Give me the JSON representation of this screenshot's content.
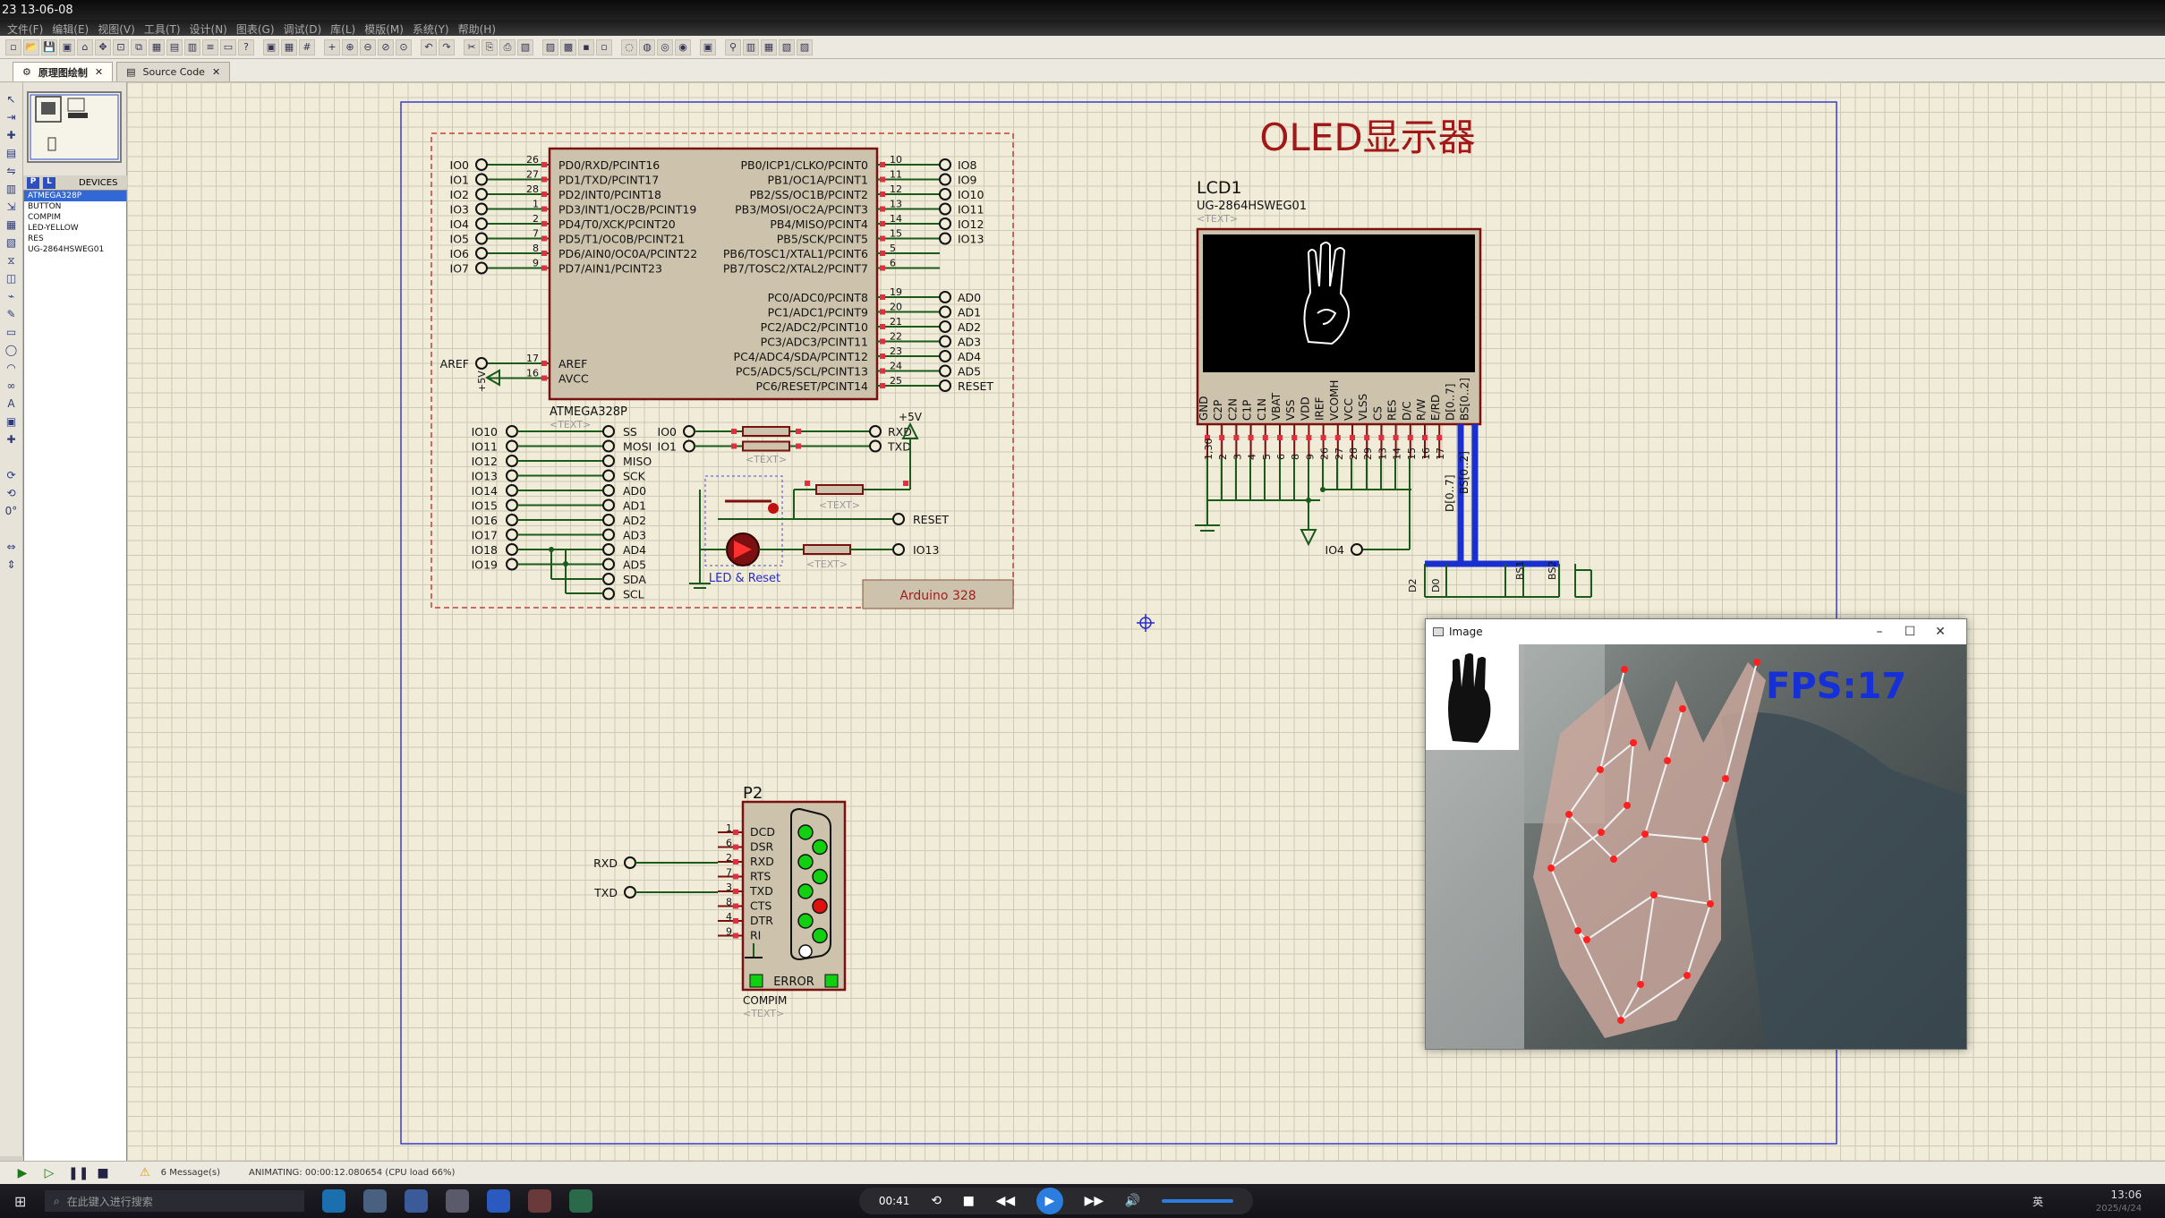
{
  "topbar": {
    "time_label": "23 13-06-08"
  },
  "menu": [
    "文件(F)",
    "编辑(E)",
    "视图(V)",
    "工具(T)",
    "设计(N)",
    "图表(G)",
    "调试(D)",
    "库(L)",
    "模版(M)",
    "系统(Y)",
    "帮助(H)"
  ],
  "tabs": [
    {
      "label": "原理图绘制",
      "active": true
    },
    {
      "label": "Source Code",
      "active": false
    }
  ],
  "devices": {
    "header": "DEVICES",
    "p_label": "P",
    "l_label": "L",
    "items": [
      "ATMEGA328P",
      "BUTTON",
      "COMPIM",
      "LED-YELLOW",
      "RES",
      "UG-2864HSWEG01"
    ],
    "selected": 0
  },
  "schematic": {
    "oled_title": "OLED显示器",
    "lcd_ref": "LCD1",
    "lcd_part": "UG-2864HSWEG01",
    "text_placeholder": "<TEXT>",
    "mcu_name": "ATMEGA328P",
    "arduino_label": "Arduino 328",
    "led_reset_label": "LED & Reset",
    "plus5v": "+5V",
    "p2_ref": "P2",
    "p2_part": "COMPIM",
    "error_label": "ERROR",
    "mcu_left_pins": [
      "PD0/RXD/PCINT16",
      "PD1/TXD/PCINT17",
      "PD2/INT0/PCINT18",
      "PD3/INT1/OC2B/PCINT19",
      "PD4/T0/XCK/PCINT20",
      "PD5/T1/OC0B/PCINT21",
      "PD6/AIN0/OC0A/PCINT22",
      "PD7/AIN1/PCINT23"
    ],
    "mcu_left_nums": [
      "26",
      "27",
      "28",
      "1",
      "2",
      "7",
      "8",
      "9"
    ],
    "mcu_left_nets": [
      "IO0",
      "IO1",
      "IO2",
      "IO3",
      "IO4",
      "IO5",
      "IO6",
      "IO7"
    ],
    "mcu_right_pins": [
      "PB0/ICP1/CLKO/PCINT0",
      "PB1/OC1A/PCINT1",
      "PB2/SS/OC1B/PCINT2",
      "PB3/MOSI/OC2A/PCINT3",
      "PB4/MISO/PCINT4",
      "PB5/SCK/PCINT5",
      "PB6/TOSC1/XTAL1/PCINT6",
      "PB7/TOSC2/XTAL2/PCINT7"
    ],
    "mcu_right_nums": [
      "10",
      "11",
      "12",
      "13",
      "14",
      "15",
      "5",
      "6"
    ],
    "mcu_right_nets": [
      "IO8",
      "IO9",
      "IO10",
      "IO11",
      "IO12",
      "IO13",
      "",
      ""
    ],
    "mcu_right_pins2": [
      "PC0/ADC0/PCINT8",
      "PC1/ADC1/PCINT9",
      "PC2/ADC2/PCINT10",
      "PC3/ADC3/PCINT11",
      "PC4/ADC4/SDA/PCINT12",
      "PC5/ADC5/SCL/PCINT13",
      "PC6/RESET/PCINT14"
    ],
    "mcu_right_nums2": [
      "19",
      "20",
      "21",
      "22",
      "23",
      "24",
      "25"
    ],
    "mcu_right_nets2": [
      "AD0",
      "AD1",
      "AD2",
      "AD3",
      "AD4",
      "AD5",
      "RESET"
    ],
    "mcu_aref_pins": [
      "AREF",
      "AVCC"
    ],
    "mcu_aref_nums": [
      "17",
      "16"
    ],
    "aref_net": "AREF",
    "hdr_left": [
      "IO10",
      "IO11",
      "IO12",
      "IO13",
      "IO14",
      "IO15",
      "IO16",
      "IO17",
      "IO18",
      "IO19"
    ],
    "hdr_right": [
      "SS",
      "MOSI",
      "MISO",
      "SCK",
      "AD0",
      "AD1",
      "AD2",
      "AD3",
      "AD4",
      "AD5",
      "SDA",
      "SCL"
    ],
    "serial_left": [
      "IO0",
      "IO1"
    ],
    "serial_right": [
      "RXD",
      "TXD"
    ],
    "reset_net": "RESET",
    "io13_net": "IO13",
    "lcd_pins": [
      "GND",
      "C2P",
      "C2N",
      "C1P",
      "C1N",
      "VBAT",
      "VSS",
      "VDD",
      "IREF",
      "VCOMH",
      "VCC",
      "VLSS",
      "CS",
      "RES",
      "D/C",
      "R/W",
      "E/RD",
      "D[0..7]",
      "BS[0..2]"
    ],
    "lcd_nums": [
      "1,30",
      "2",
      "3",
      "4",
      "5",
      "6",
      "8",
      "9",
      "26",
      "27",
      "28",
      "29",
      "13",
      "14",
      "15",
      "16",
      "17"
    ],
    "io4_net": "IO4",
    "bus_labels": [
      "D[0..7]",
      "BS[0..2]",
      "D2",
      "D0",
      "BS1",
      "BS2"
    ],
    "p2_pins": [
      "DCD",
      "DSR",
      "RXD",
      "RTS",
      "TXD",
      "CTS",
      "DTR",
      "RI"
    ],
    "p2_nums": [
      "1",
      "6",
      "2",
      "7",
      "3",
      "8",
      "4",
      "9"
    ],
    "p2_nets": [
      "RXD",
      "TXD"
    ]
  },
  "image_window": {
    "title": "Image",
    "fps": "FPS:17"
  },
  "statusbar": {
    "messages": "6 Message(s)",
    "animating": "ANIMATING: 00:00:12.080654 (CPU load 66%)"
  },
  "taskbar": {
    "search_placeholder": "在此键入进行搜索",
    "media_time": "00:41",
    "clock_time": "13:06",
    "clock_date": "2025/4/24",
    "lang": "英"
  },
  "colors": {
    "wire": "#1a5a1a",
    "component_fill": "#cdc3ad",
    "component_stroke": "#7a1010",
    "bus": "#1a2fd0",
    "accent_blue": "#3168d5",
    "fps_text": "#1530d8",
    "hand_line": "#f2f2f2",
    "hand_joint": "#ff2020"
  }
}
